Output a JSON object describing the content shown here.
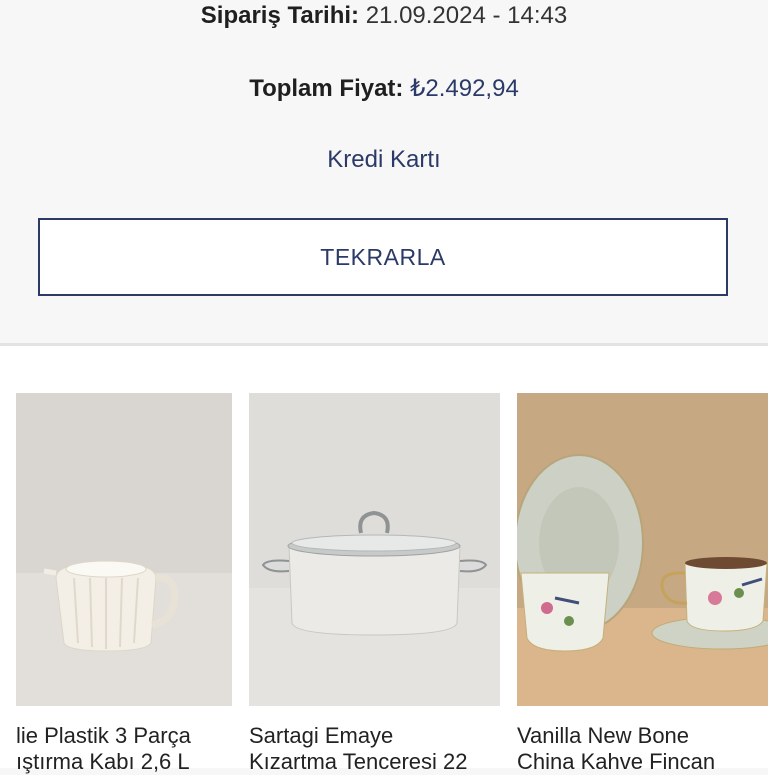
{
  "order": {
    "date_label": "Sipariş Tarihi:",
    "date_value": "21.09.2024 - 14:43",
    "total_label": "Toplam Fiyat:",
    "total_value": "₺2.492,94",
    "payment_method": "Kredi Kartı",
    "repeat_button": "TEKRARLA"
  },
  "products": [
    {
      "line1": "lie Plastik 3 Parça",
      "line2": "ıştırma Kabı 2,6 L"
    },
    {
      "line1": "Sartagi Emaye",
      "line2": "Kızartma Tenceresi 22"
    },
    {
      "line1": "Vanilla New Bone",
      "line2": "China Kahve Fincan"
    }
  ]
}
